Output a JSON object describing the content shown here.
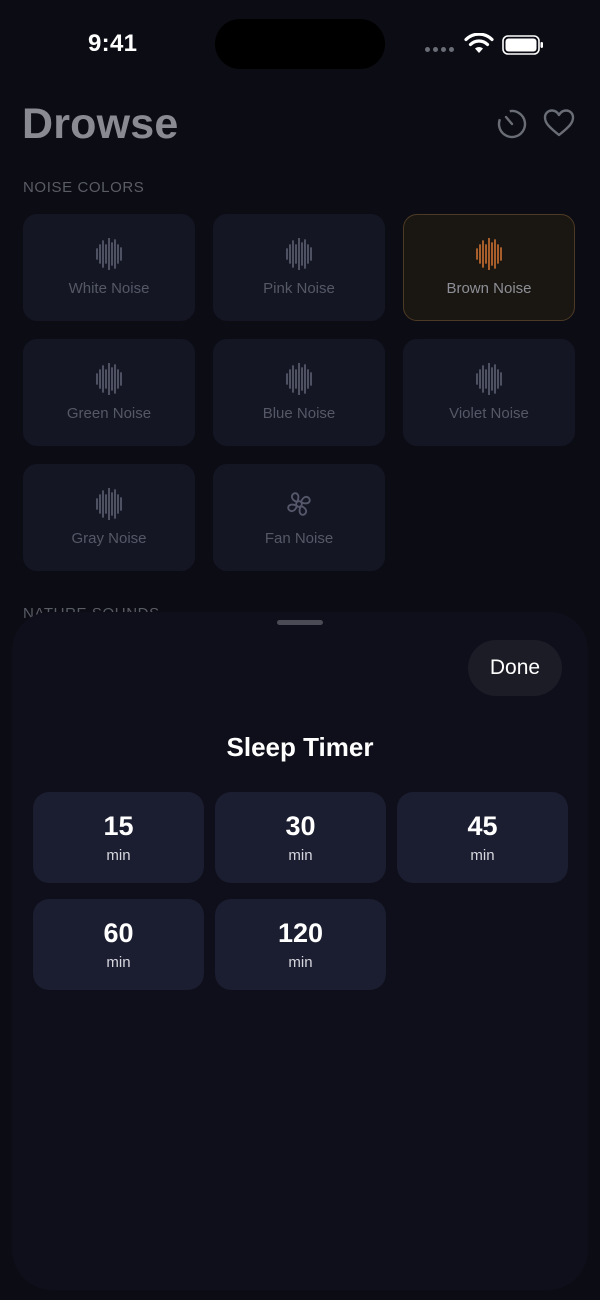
{
  "status_bar": {
    "time": "9:41"
  },
  "header": {
    "title": "Drowse"
  },
  "sections": {
    "noise_colors": "NOISE COLORS",
    "nature_sounds": "NATURE SOUNDS"
  },
  "noise_tiles": [
    {
      "label": "White Noise",
      "icon": "waveform-icon",
      "active": false
    },
    {
      "label": "Pink Noise",
      "icon": "waveform-icon",
      "active": false
    },
    {
      "label": "Brown Noise",
      "icon": "waveform-icon",
      "active": true
    },
    {
      "label": "Green Noise",
      "icon": "waveform-icon",
      "active": false
    },
    {
      "label": "Blue Noise",
      "icon": "waveform-icon",
      "active": false
    },
    {
      "label": "Violet Noise",
      "icon": "waveform-icon",
      "active": false
    },
    {
      "label": "Gray Noise",
      "icon": "waveform-icon",
      "active": false
    },
    {
      "label": "Fan Noise",
      "icon": "fan-icon",
      "active": false
    }
  ],
  "sheet": {
    "done_label": "Done",
    "title": "Sleep Timer",
    "options": [
      {
        "value": "15",
        "unit": "min"
      },
      {
        "value": "30",
        "unit": "min"
      },
      {
        "value": "45",
        "unit": "min"
      },
      {
        "value": "60",
        "unit": "min"
      },
      {
        "value": "120",
        "unit": "min"
      }
    ]
  },
  "colors": {
    "accent": "#b8672e",
    "background": "#0b0c14",
    "sheet": "#0e0f1a",
    "option": "#1b1d30"
  }
}
